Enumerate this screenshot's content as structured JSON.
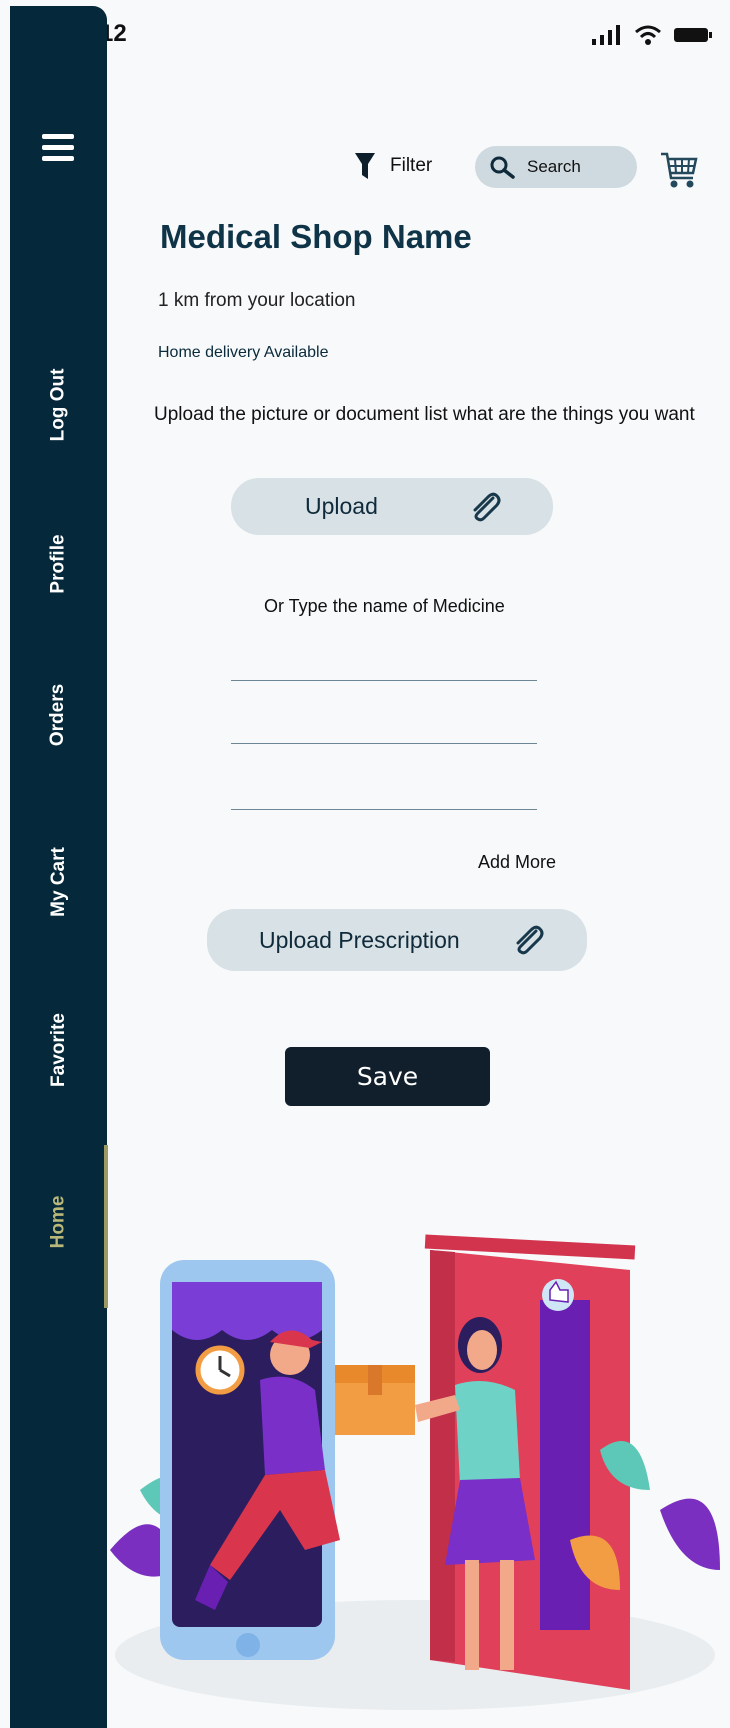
{
  "status": {
    "time": "12"
  },
  "sidebar": {
    "items": [
      {
        "label": "Log Out"
      },
      {
        "label": "Profile"
      },
      {
        "label": "Orders"
      },
      {
        "label": "My Cart"
      },
      {
        "label": "Favorite"
      },
      {
        "label": "Home",
        "active": true
      }
    ]
  },
  "header": {
    "filter_label": "Filter",
    "search_placeholder": "Search"
  },
  "shop": {
    "name": "Medical Shop Name",
    "distance": "1 km from your location",
    "delivery": "Home delivery Available"
  },
  "form": {
    "instruction": "Upload the picture or document list what are the things you want",
    "upload_label": "Upload",
    "or_type_label": "Or Type the name of Medicine",
    "medicine_inputs": [
      "",
      "",
      ""
    ],
    "add_more_label": "Add More",
    "upload_prescription_label": "Upload Prescription",
    "save_label": "Save"
  },
  "icons": {
    "menu": "hamburger-menu-icon",
    "filter": "funnel-icon",
    "search": "magnifier-icon",
    "cart": "shopping-cart-icon",
    "attach": "paperclip-icon"
  },
  "colors": {
    "sidebar": "#05293b",
    "active_item": "#b9b779",
    "pill": "#d8e1e5",
    "save_button": "#111e2b",
    "heading": "#0f3347"
  }
}
